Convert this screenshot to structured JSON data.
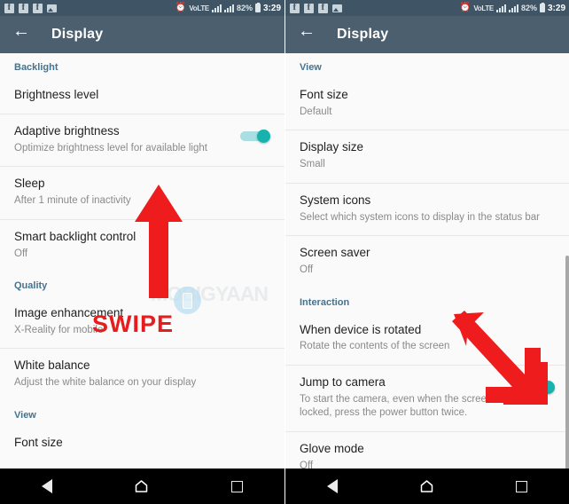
{
  "statusbar": {
    "notification_icons": [
      "facebook-icon",
      "facebook-icon",
      "facebook-icon",
      "photo-icon"
    ],
    "alarm_glyph": "⏰",
    "volte_label": "VoLTE",
    "battery_percent": "82%",
    "time": "3:29"
  },
  "appbar": {
    "title": "Display",
    "back_icon": "back-arrow-icon"
  },
  "navbar": {
    "back_label": "Back",
    "home_label": "Home",
    "recents_label": "Recents"
  },
  "colors": {
    "appbar": "#4b5f6e",
    "statusbar": "#3f5464",
    "section_header": "#45738f",
    "toggle_on": "#18b2ae",
    "toggle_track": "#a9dfe2",
    "annotation_red": "#e71c1c",
    "background": "#fafafa",
    "divider": "#e7e7e7"
  },
  "left_screen": {
    "sections": [
      {
        "header": "Backlight",
        "rows": [
          {
            "title": "Brightness level",
            "sub": "",
            "toggle": null
          },
          {
            "title": "Adaptive brightness",
            "sub": "Optimize brightness level for available light",
            "toggle": "on"
          },
          {
            "title": "Sleep",
            "sub": "After 1 minute of inactivity",
            "toggle": null
          },
          {
            "title": "Smart backlight control",
            "sub": "Off",
            "toggle": null
          }
        ]
      },
      {
        "header": "Quality",
        "rows": [
          {
            "title": "Image enhancement",
            "sub": "X-Reality for mobile",
            "toggle": null
          },
          {
            "title": "White balance",
            "sub": "Adjust the white balance on your display",
            "toggle": null
          }
        ]
      },
      {
        "header": "View",
        "rows": [
          {
            "title": "Font size",
            "sub": "",
            "toggle": null
          }
        ]
      }
    ],
    "annotation": {
      "arrow": "arrow-up-icon",
      "label": "SWIPE"
    },
    "watermark": "MOBIGYAAN"
  },
  "right_screen": {
    "sections": [
      {
        "header": "View",
        "rows": [
          {
            "title": "Font size",
            "sub": "Default",
            "toggle": null
          },
          {
            "title": "Display size",
            "sub": "Small",
            "toggle": null
          },
          {
            "title": "System icons",
            "sub": "Select which system icons to display in the status bar",
            "toggle": null
          },
          {
            "title": "Screen saver",
            "sub": "Off",
            "toggle": null
          }
        ]
      },
      {
        "header": "Interaction",
        "rows": [
          {
            "title": "When device is rotated",
            "sub": "Rotate the contents of the screen",
            "toggle": null
          },
          {
            "title": "Jump to camera",
            "sub": "To start the camera, even when the screen is locked, press the power button twice.",
            "toggle": "on"
          },
          {
            "title": "Glove mode",
            "sub": "Off",
            "toggle": null
          }
        ]
      }
    ],
    "annotation": {
      "arrow": "arrow-diagonal-down-right-icon"
    }
  }
}
